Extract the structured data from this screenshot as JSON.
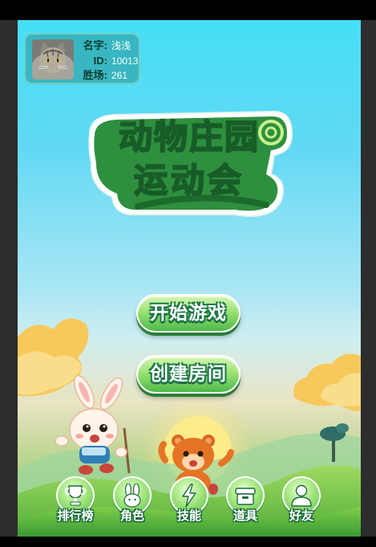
{
  "player": {
    "name_label": "名字:",
    "name": "浅浅",
    "id_label": "ID:",
    "id": "10013",
    "wins_label": "胜场:",
    "wins": "261",
    "avatar_icon": "cat-avatar-icon"
  },
  "title": {
    "line1": "动物庄园",
    "line2": "运动会"
  },
  "menu": {
    "start_label": "开始游戏",
    "create_room_label": "创建房间"
  },
  "dock": [
    {
      "label": "排行榜",
      "icon": "trophy-icon"
    },
    {
      "label": "角色",
      "icon": "rabbit-icon"
    },
    {
      "label": "技能",
      "icon": "lightning-icon"
    },
    {
      "label": "道具",
      "icon": "box-icon"
    },
    {
      "label": "好友",
      "icon": "person-icon"
    }
  ],
  "colors": {
    "sky_top": "#45dff6",
    "button_green": "#4fb94a",
    "title_green": "#2f8f3a",
    "outline_green": "#1f7a48"
  }
}
